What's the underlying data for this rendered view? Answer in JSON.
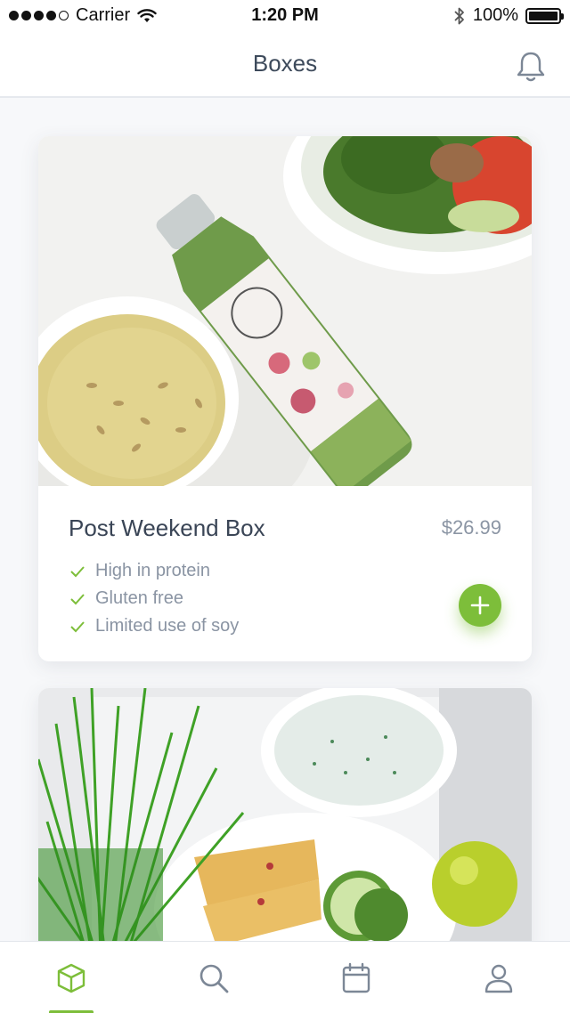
{
  "status_bar": {
    "carrier": "Carrier",
    "time": "1:20 PM",
    "battery": "100%",
    "battery_level": 1.0
  },
  "header": {
    "title": "Boxes",
    "bell_icon": "bell-icon"
  },
  "cards": [
    {
      "title": "Post Weekend Box",
      "price": "$26.99",
      "features": [
        "High in protein",
        "Gluten free",
        "Limited use of soy"
      ],
      "add_icon": "plus-icon"
    }
  ],
  "tabs": [
    {
      "name": "boxes",
      "icon": "box-icon",
      "active": true
    },
    {
      "name": "search",
      "icon": "search-icon",
      "active": false
    },
    {
      "name": "calendar",
      "icon": "calendar-icon",
      "active": false
    },
    {
      "name": "profile",
      "icon": "user-icon",
      "active": false
    }
  ],
  "colors": {
    "accent": "#7dbe3a",
    "title_text": "#3d4a5b",
    "muted_text": "#8a94a3",
    "icon_gray": "#7c8796"
  }
}
